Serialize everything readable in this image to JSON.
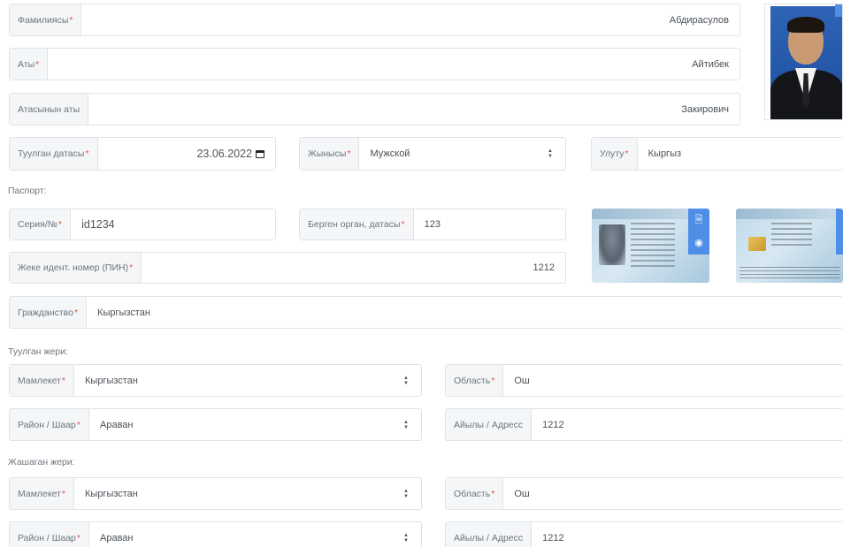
{
  "personal": {
    "surname": {
      "label": "Фамилиясы",
      "value": "Абдирасулов"
    },
    "name": {
      "label": "Аты",
      "value": "Айтибек"
    },
    "patronymic": {
      "label": "Атасынын аты",
      "value": "Закирович"
    },
    "birth_date": {
      "label": "Туулган датасы",
      "value": "23.06.2022"
    },
    "gender": {
      "label": "Жынысы",
      "value": "Мужской"
    },
    "nationality": {
      "label": "Улуту",
      "value": "Кыргыз"
    }
  },
  "passport": {
    "section_label": "Паспорт:",
    "series": {
      "label": "Серия/№",
      "value": "id1234"
    },
    "issued_by": {
      "label": "Берген орган, датасы",
      "value": "123"
    },
    "pin": {
      "label": "Жеке идент. номер (ПИН)",
      "value": "1212"
    },
    "citizenship": {
      "label": "Гражданство",
      "value": "Кыргызстан"
    }
  },
  "birth_place": {
    "section_label": "Туулган жери:",
    "country": {
      "label": "Мамлекет",
      "value": "Кыргызстан"
    },
    "region": {
      "label": "Область",
      "value": "Ош"
    },
    "district": {
      "label": "Район / Шаар",
      "value": "Араван"
    },
    "village": {
      "label": "Айылы / Адресс",
      "value": "1212"
    }
  },
  "residence": {
    "section_label": "Жашаган жери:",
    "country": {
      "label": "Мамлекет",
      "value": "Кыргызстан"
    },
    "region": {
      "label": "Область",
      "value": "Ош"
    },
    "district": {
      "label": "Район / Шаар",
      "value": "Араван"
    },
    "village": {
      "label": "Айылы / Адресс",
      "value": "1212"
    }
  },
  "required_mark": "*",
  "icons": {
    "upload": "file-icon",
    "camera": "camera-icon"
  },
  "colors": {
    "required": "#e2574c",
    "label_bg": "#f4f6f8",
    "accent": "#4e8ee6"
  }
}
